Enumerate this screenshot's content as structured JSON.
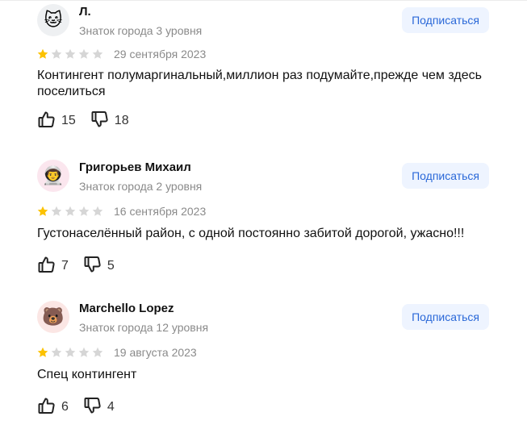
{
  "subscribe_label": "Подписаться",
  "star_filled_color": "#fcc200",
  "star_empty_color": "#d6d6d6",
  "reviews": [
    {
      "avatar_emoji": "🐱",
      "avatar_bg": "#eef0f2",
      "name": "Л.",
      "level": "Знаток города 3 уровня",
      "rating": 1,
      "date": "29 сентября 2023",
      "text": "Контингент полумаргинальный,миллион раз подумайте,прежде чем здесь поселиться",
      "likes": "15",
      "dislikes": "18"
    },
    {
      "avatar_emoji": "👨‍🚀",
      "avatar_bg": "#fbe6ee",
      "name": "Григорьев Михаил",
      "level": "Знаток города 2 уровня",
      "rating": 1,
      "date": "16 сентября 2023",
      "text": "Густонаселённый район, с одной постоянно забитой дорогой, ужасно!!!",
      "likes": "7",
      "dislikes": "5"
    },
    {
      "avatar_emoji": "🐻",
      "avatar_bg": "#fbe6e4",
      "name": "Marchello Lopez",
      "level": "Знаток города 12 уровня",
      "rating": 1,
      "date": "19 августа 2023",
      "text": "Спец контингент",
      "likes": "6",
      "dislikes": "4"
    }
  ]
}
